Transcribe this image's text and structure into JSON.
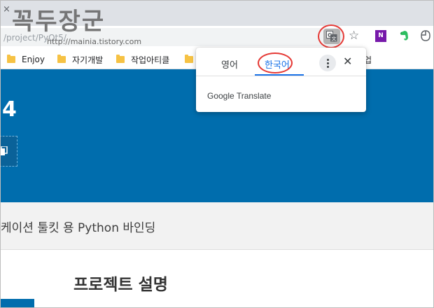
{
  "watermark": {
    "text": "꼭두장군",
    "url": "http://mainia.tistory.com"
  },
  "tab": {
    "close_glyph": "×"
  },
  "address_bar": {
    "url": "/project/PyQt5/"
  },
  "toolbar": {
    "translate_icon": "translate-icon",
    "star_glyph": "☆",
    "ext_onenote_text": "N",
    "ext_onenote_color": "#7719aa",
    "ext_evernote_color": "#2dbe60"
  },
  "bookmarks": [
    {
      "label": "Enjoy"
    },
    {
      "label": "자기개발"
    },
    {
      "label": "작업아티클"
    },
    {
      "label": "업"
    }
  ],
  "page": {
    "hero_text": "4",
    "hero_color": "#006dad",
    "subtitle": "케이션 툴킷 용 Python 바인딩",
    "section_title": "프로젝트 설명"
  },
  "translate_popup": {
    "tabs": [
      {
        "label": "영어",
        "selected": false
      },
      {
        "label": "한국어",
        "selected": true
      }
    ],
    "more_label": "⋮",
    "close_glyph": "✕",
    "brand": "Google Translate",
    "accent_color": "#1a73e8",
    "highlight_color": "#e53935"
  }
}
